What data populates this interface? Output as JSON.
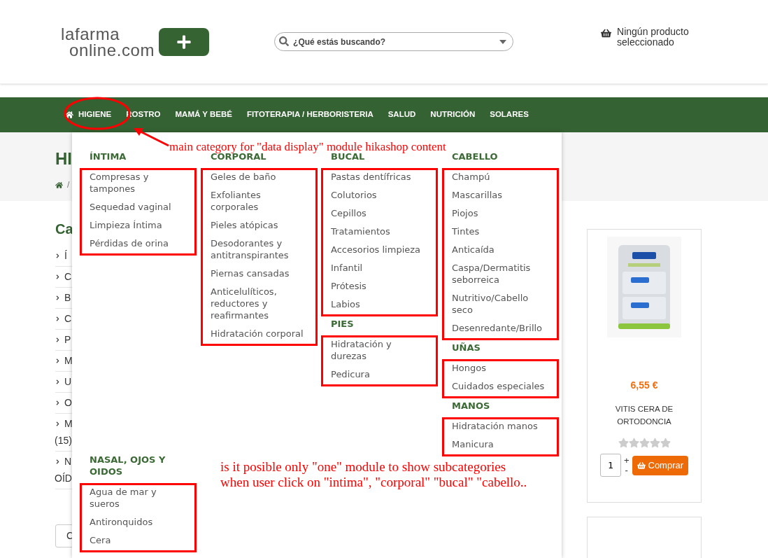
{
  "header": {
    "logo_lines": [
      "lafarma",
      "online.com"
    ],
    "search": {
      "placeholder": "¿Qué estás buscando?"
    },
    "cart_text": "Ningún producto seleccionado"
  },
  "nav": {
    "items": [
      "HIGIENE",
      "ROSTRO",
      "MAMÁ Y BEBÉ",
      "FITOTERAPIA / HERBORISTERIA",
      "SALUD",
      "NUTRICIÓN",
      "SOLARES"
    ]
  },
  "page_title": "HI",
  "breadcrumb_separator": "/",
  "sidebar": {
    "title": "Ca",
    "items": [
      {
        "label": "Í"
      },
      {
        "label": "C"
      },
      {
        "label": "B"
      },
      {
        "label": "C"
      },
      {
        "label": "P"
      },
      {
        "label": "M"
      },
      {
        "label": "U"
      },
      {
        "label": "O"
      },
      {
        "label": "M",
        "line_2": "(15)"
      },
      {
        "label": "N",
        "line_2": "OÍD"
      }
    ],
    "button": "C"
  },
  "mega_menu": {
    "columns": [
      {
        "groups": [
          {
            "title": "ÍNTIMA",
            "highlighted": true,
            "items": [
              "Compresas y tampones",
              "Sequedad vaginal",
              "Limpieza Íntima",
              "Pérdidas de orina"
            ]
          },
          {
            "title": "NASAL, OJOS Y OIDOS",
            "highlighted": true,
            "items": [
              "Agua de mar y sueros",
              "Antironquidos",
              "Cera"
            ]
          }
        ]
      },
      {
        "groups": [
          {
            "title": "CORPORAL",
            "highlighted": true,
            "items": [
              "Geles de baño",
              "Exfoliantes corporales",
              "Pieles atópicas",
              "Desodorantes y antitranspirantes",
              "Piernas cansadas",
              "Anticelulíticos, reductores y reafirmantes",
              "Hidratación corporal"
            ]
          }
        ]
      },
      {
        "groups": [
          {
            "title": "BUCAL",
            "highlighted": true,
            "items": [
              "Pastas dentífricas",
              "Colutorios",
              "Cepillos",
              "Tratamientos",
              "Accesorios limpieza",
              "Infantil",
              "Prótesis",
              "Labios"
            ]
          },
          {
            "title": "PIES",
            "highlighted": true,
            "items": [
              "Hidratación y durezas",
              "Pedicura"
            ]
          }
        ]
      },
      {
        "groups": [
          {
            "title": "CABELLO",
            "highlighted": true,
            "items": [
              "Champú",
              "Mascarillas",
              "Piojos",
              "Tintes",
              "Anticaída",
              "Caspa/Dermatitis seborreica",
              "Nutritivo/Cabello seco",
              "Desenredante/Brillo"
            ]
          },
          {
            "title": "UÑAS",
            "highlighted": true,
            "items": [
              "Hongos",
              "Cuidados especiales"
            ]
          },
          {
            "title": "MANOS",
            "highlighted": true,
            "items": [
              "Hidratación manos",
              "Manicura"
            ]
          }
        ]
      }
    ]
  },
  "product": {
    "kind": "picture",
    "price": "6,55 €",
    "name": "VITIS CERA DE ORTODONCIA",
    "stars": 0,
    "quantity": "1",
    "plus": "+",
    "minus": "-",
    "buy_button": "Comprar"
  },
  "annotations": [
    "main category for \"data display\" module hikashop content",
    "is it posible only \"one\" module to show subcategories when user click on \"intima\", \"corporal\" \"bucal\" \"cabello.."
  ]
}
